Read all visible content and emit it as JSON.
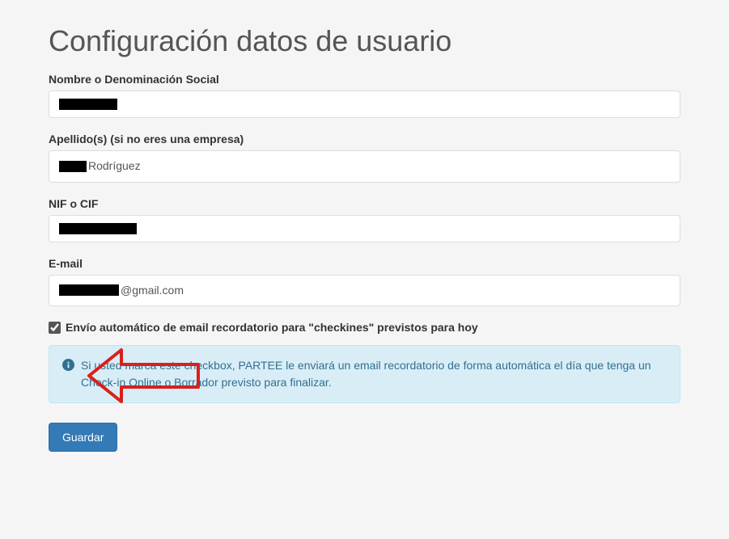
{
  "heading": "Configuración datos de usuario",
  "fields": {
    "name": {
      "label": "Nombre o Denominación Social",
      "value_prefix_redacted_width": 72,
      "value_suffix": ""
    },
    "surname": {
      "label": "Apellido(s) (si no eres una empresa)",
      "value_prefix_redacted_width": 34,
      "value_suffix": "Rodríguez"
    },
    "nif": {
      "label": "NIF o CIF",
      "value_prefix_redacted_width": 96,
      "value_suffix": ""
    },
    "email": {
      "label": "E-mail",
      "value_prefix_redacted_width": 74,
      "value_suffix": "@gmail.com"
    }
  },
  "checkbox": {
    "checked": true,
    "label": "Envío automático de email recordatorio para \"checkines\" previstos para hoy"
  },
  "info_alert": "Si usted marca este checkbox, PARTEE le enviará un email recordatorio de forma automática el día que tenga un Check-in Online o Borrador previsto para finalizar.",
  "buttons": {
    "save": "Guardar"
  },
  "annotation": {
    "arrow_color": "#d9201c"
  }
}
